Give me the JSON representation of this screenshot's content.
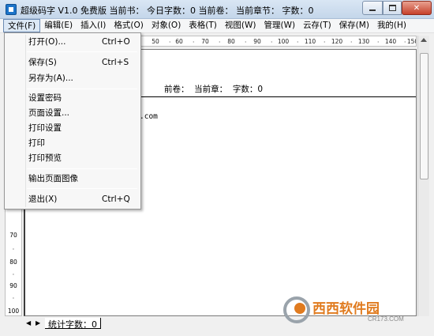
{
  "title": "超级码字 V1.0 免费版  当前书：  今日字数：0  当前卷：    当前章节：  字数：0",
  "menu": [
    {
      "label": "文件(F)"
    },
    {
      "label": "编辑(E)"
    },
    {
      "label": "插入(I)"
    },
    {
      "label": "格式(O)"
    },
    {
      "label": "对象(O)"
    },
    {
      "label": "表格(T)"
    },
    {
      "label": "视图(W)"
    },
    {
      "label": "管理(W)"
    },
    {
      "label": "云存(T)"
    },
    {
      "label": "保存(M)"
    },
    {
      "label": "我的(H)"
    }
  ],
  "file_menu": {
    "open": {
      "label": "打开(O)...",
      "shortcut": "Ctrl+O"
    },
    "save": {
      "label": "保存(S)",
      "shortcut": "Ctrl+S"
    },
    "save_as": {
      "label": "另存为(A)..."
    },
    "set_password": {
      "label": "设置密码"
    },
    "page_setup": {
      "label": "页面设置..."
    },
    "print_setup": {
      "label": "打印设置"
    },
    "print": {
      "label": "打印"
    },
    "print_preview": {
      "label": "打印预览"
    },
    "export_page_image": {
      "label": "输出页面图像"
    },
    "exit": {
      "label": "退出(X)",
      "shortcut": "Ctrl+Q"
    }
  },
  "ruler_h": [
    "50",
    "60",
    "70",
    "80",
    "90",
    "100",
    "110",
    "120",
    "130",
    "140",
    "150"
  ],
  "ruler_v": [
    "70",
    "80",
    "90",
    "100"
  ],
  "editor": {
    "status_line": "前卷：  当前章：  字数：0",
    "url_fragment": ".com"
  },
  "bottom": {
    "total_label": "统计字数：0"
  },
  "watermark": {
    "text": "西西软件园",
    "site": "CR173.COM"
  },
  "colors": {
    "title_bg": "#d3e1f1",
    "close_btn": "#c7412b",
    "menu_active": "#dce8f5"
  }
}
